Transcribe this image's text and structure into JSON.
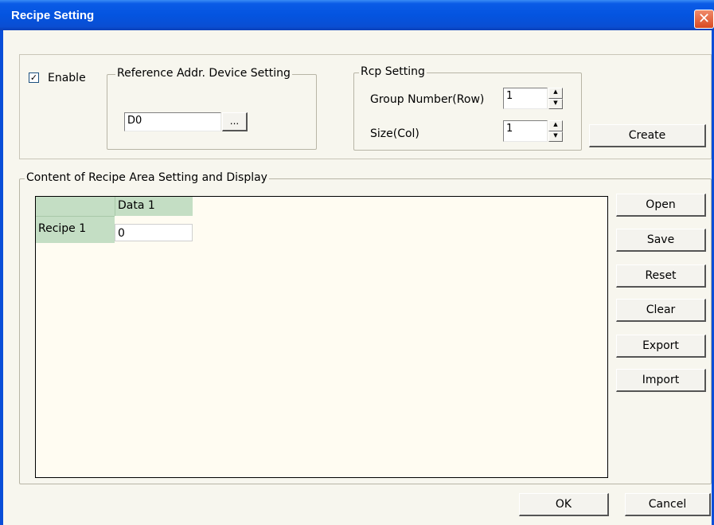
{
  "window": {
    "title": "Recipe Setting",
    "close_glyph": "✕"
  },
  "enable": {
    "label": "Enable",
    "checked": true,
    "glyph": "✓"
  },
  "reference": {
    "legend": "Reference Addr. Device Setting",
    "value": "D0",
    "browse_label": "..."
  },
  "rcp": {
    "legend": "Rcp Setting",
    "group_label": "Group Number(Row)",
    "group_value": "1",
    "size_label": "Size(Col)",
    "size_value": "1",
    "up_glyph": "▲",
    "down_glyph": "▼"
  },
  "create_label": "Create",
  "content": {
    "legend": "Content of Recipe Area Setting and Display",
    "columns": [
      "Data 1"
    ],
    "rows": [
      {
        "label": "Recipe 1",
        "values": [
          "0"
        ]
      }
    ],
    "header_color": "#c4dec4"
  },
  "side_buttons": [
    "Open",
    "Save",
    "Reset",
    "Clear",
    "Export",
    "Import"
  ],
  "footer": {
    "ok_label": "OK",
    "cancel_label": "Cancel"
  }
}
